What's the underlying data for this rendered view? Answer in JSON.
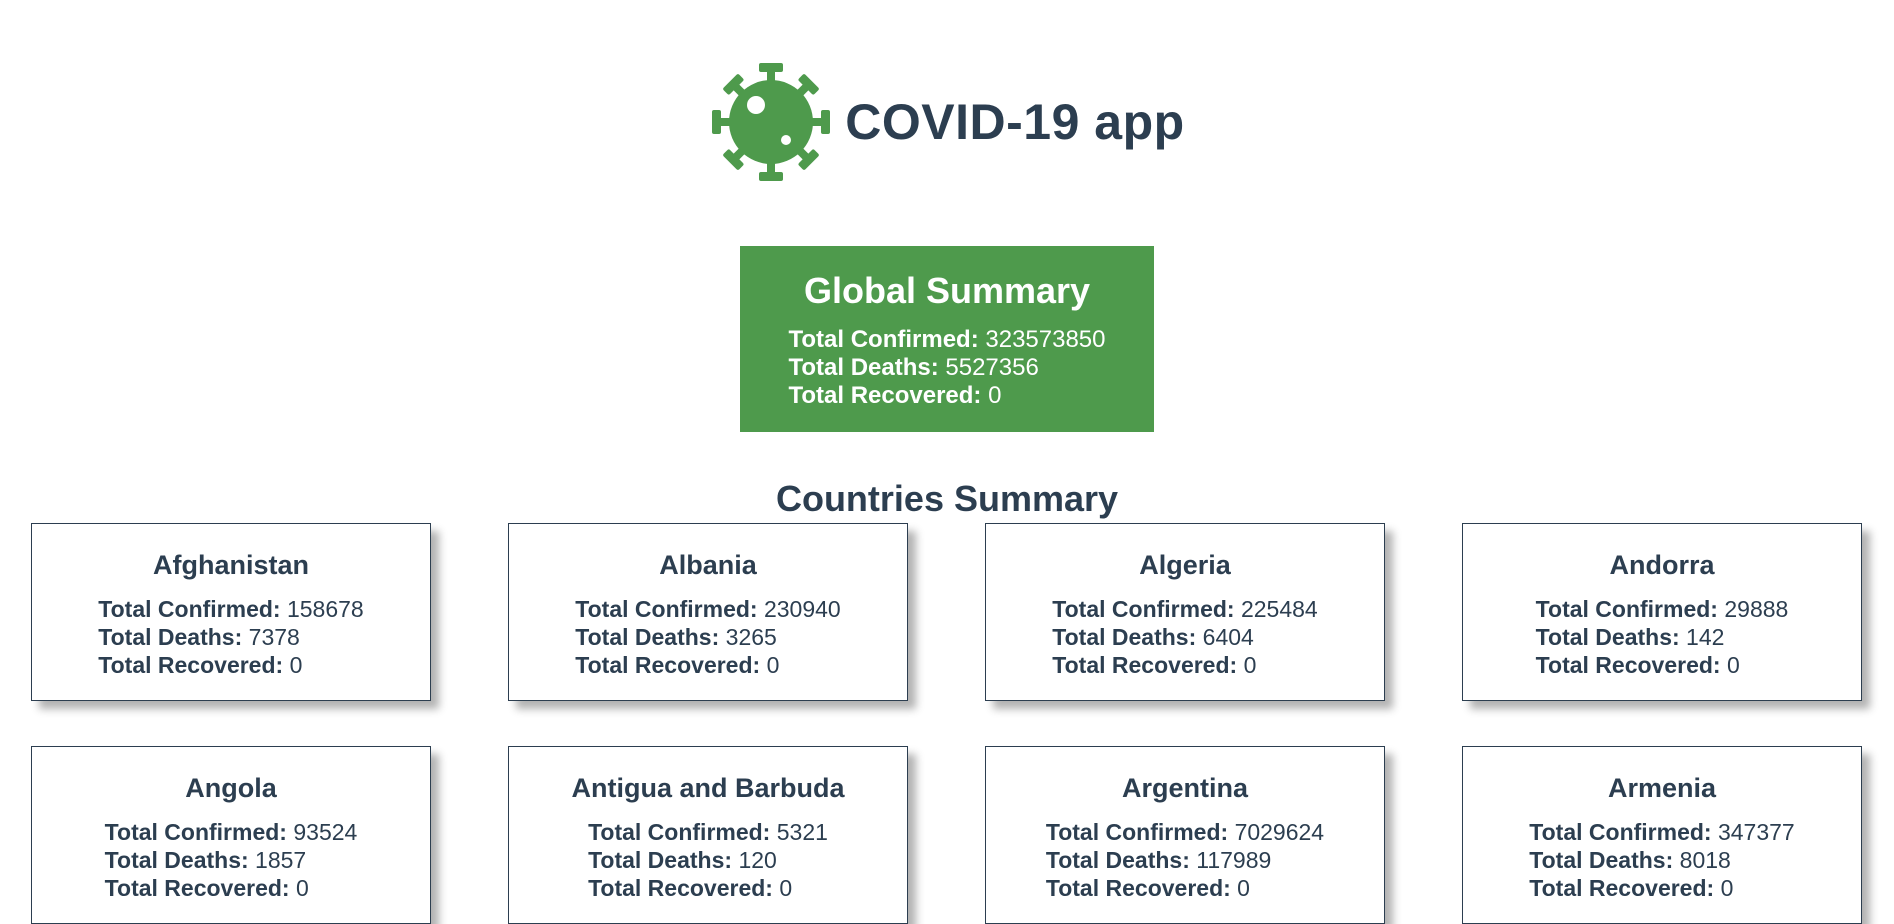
{
  "app": {
    "title": "COVID-19 app",
    "logo_icon": "virus-icon",
    "accent_color": "#4e9a4c",
    "text_color": "#2c3e50"
  },
  "global": {
    "title": "Global Summary",
    "confirmed_label": "Total Confirmed:",
    "confirmed": "323573850",
    "deaths_label": "Total Deaths:",
    "deaths": "5527356",
    "recovered_label": "Total Recovered:",
    "recovered": "0"
  },
  "countries_title": "Countries Summary",
  "labels": {
    "confirmed": "Total Confirmed:",
    "deaths": "Total Deaths:",
    "recovered": "Total Recovered:"
  },
  "countries": [
    {
      "name": "Afghanistan",
      "confirmed": "158678",
      "deaths": "7378",
      "recovered": "0"
    },
    {
      "name": "Albania",
      "confirmed": "230940",
      "deaths": "3265",
      "recovered": "0"
    },
    {
      "name": "Algeria",
      "confirmed": "225484",
      "deaths": "6404",
      "recovered": "0"
    },
    {
      "name": "Andorra",
      "confirmed": "29888",
      "deaths": "142",
      "recovered": "0"
    },
    {
      "name": "Angola",
      "confirmed": "93524",
      "deaths": "1857",
      "recovered": "0"
    },
    {
      "name": "Antigua and Barbuda",
      "confirmed": "5321",
      "deaths": "120",
      "recovered": "0"
    },
    {
      "name": "Argentina",
      "confirmed": "7029624",
      "deaths": "117989",
      "recovered": "0"
    },
    {
      "name": "Armenia",
      "confirmed": "347377",
      "deaths": "8018",
      "recovered": "0"
    }
  ]
}
